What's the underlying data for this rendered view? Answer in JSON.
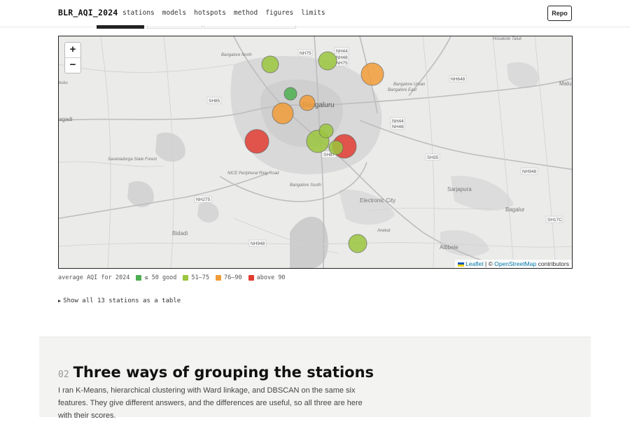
{
  "nav": {
    "brand": "BLR_AQI_2024",
    "links": [
      "stations",
      "models",
      "hotspots",
      "method",
      "figures",
      "limits"
    ],
    "repo_label": "Repo"
  },
  "map": {
    "zoom_in": "+",
    "zoom_out": "−",
    "attribution": {
      "leaflet": "Leaflet",
      "separator": " | © ",
      "osm": "OpenStreetMap",
      "suffix": " contributors"
    },
    "place_labels": {
      "bengaluru": "Bengaluru",
      "electronic_city": "Electronic City",
      "sarjapura": "Sarjapura",
      "bagalur": "Bagalur",
      "attibele": "Attibele",
      "bidadi": "Bidadi",
      "agadi": "agadi",
      "malu": "Malu",
      "bangalore_north": "Bangalore North",
      "bangalore_south": "Bangalore South",
      "bangalore_east": "Bangalore East",
      "bangalore_urban": "Bangalore Urban",
      "hosakote": "Hosakote Taluk",
      "savanadurga": "Savanadurga State Forest",
      "anekal": "Anekal",
      "nice_road": "NICE Peripheral Ring Road",
      "kuku": "kuku"
    },
    "road_labels": [
      "NH75",
      "NH44",
      "NH48",
      "NH75",
      "NH648",
      "SH85",
      "NH44",
      "NH48",
      "SH35",
      "NH948",
      "NH275",
      "SH87",
      "NH948",
      "SH17C"
    ],
    "stations": [
      {
        "category": "51-75",
        "color": "#9bc53d"
      },
      {
        "category": "51-75",
        "color": "#9bc53d"
      },
      {
        "category": "76-90",
        "color": "#f29c38"
      },
      {
        "category": "≤ 50 good",
        "color": "#4caf50"
      },
      {
        "category": "76-90",
        "color": "#f29c38"
      },
      {
        "category": "76-90",
        "color": "#f29c38"
      },
      {
        "category": "above 90",
        "color": "#e03c31"
      },
      {
        "category": "51-75",
        "color": "#9bc53d"
      },
      {
        "category": "51-75",
        "color": "#9bc53d"
      },
      {
        "category": "above 90",
        "color": "#e03c31"
      },
      {
        "category": "51-75",
        "color": "#9bc53d"
      },
      {
        "category": "51-75",
        "color": "#9bc53d"
      }
    ]
  },
  "legend": {
    "label": "average AQI for 2024",
    "items": [
      {
        "label": "≤ 50 good",
        "color": "#4caf50"
      },
      {
        "label": "51–75",
        "color": "#9bc53d"
      },
      {
        "label": "76–90",
        "color": "#f29c38"
      },
      {
        "label": "above 90",
        "color": "#e03c31"
      }
    ]
  },
  "table_toggle": "Show all 13 stations as a table",
  "section": {
    "number": "02",
    "title": "Three ways of grouping the stations",
    "body": "I ran K-Means, hierarchical clustering with Ward linkage, and DBSCAN on the same six features. They give different answers, and the differences are useful, so all three are here with their scores."
  }
}
